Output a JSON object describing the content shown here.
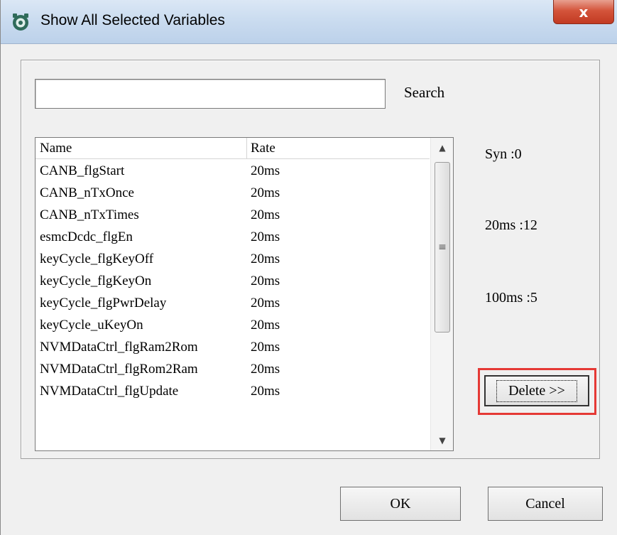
{
  "window": {
    "title": "Show All Selected Variables",
    "close_label": "x"
  },
  "search": {
    "value": "",
    "placeholder": "",
    "label": "Search"
  },
  "list": {
    "columns": [
      "Name",
      "Rate"
    ],
    "rows": [
      {
        "name": "CANB_flgStart",
        "rate": "20ms"
      },
      {
        "name": "CANB_nTxOnce",
        "rate": "20ms"
      },
      {
        "name": "CANB_nTxTimes",
        "rate": "20ms"
      },
      {
        "name": "esmcDcdc_flgEn",
        "rate": "20ms"
      },
      {
        "name": "keyCycle_flgKeyOff",
        "rate": "20ms"
      },
      {
        "name": "keyCycle_flgKeyOn",
        "rate": "20ms"
      },
      {
        "name": "keyCycle_flgPwrDelay",
        "rate": "20ms"
      },
      {
        "name": "keyCycle_uKeyOn",
        "rate": "20ms"
      },
      {
        "name": "NVMDataCtrl_flgRam2Rom",
        "rate": "20ms"
      },
      {
        "name": "NVMDataCtrl_flgRom2Ram",
        "rate": "20ms"
      },
      {
        "name": "NVMDataCtrl_flgUpdate",
        "rate": "20ms"
      }
    ],
    "scroll_up_glyph": "▲",
    "scroll_down_glyph": "▼",
    "thumb_grip_glyph": "≡"
  },
  "stats": {
    "syn": "Syn :0",
    "rate20": "20ms :12",
    "rate100": "100ms :5"
  },
  "buttons": {
    "delete": "Delete >>",
    "ok": "OK",
    "cancel": "Cancel"
  },
  "colors": {
    "highlight": "#e53935",
    "titlebar": "#c9dbef",
    "close": "#d4543b"
  }
}
